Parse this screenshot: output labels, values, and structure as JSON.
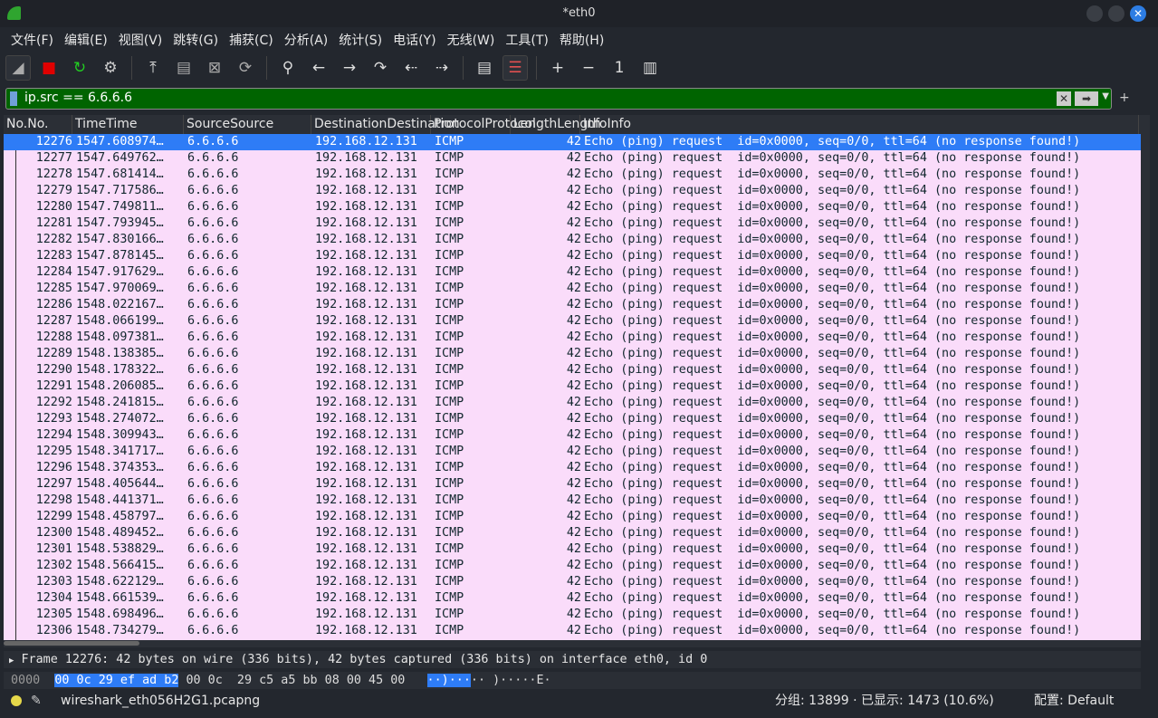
{
  "window": {
    "title": "*eth0",
    "close": "✕"
  },
  "menu": [
    "文件(F)",
    "编辑(E)",
    "视图(V)",
    "跳转(G)",
    "捕获(C)",
    "分析(A)",
    "统计(S)",
    "电话(Y)",
    "无线(W)",
    "工具(T)",
    "帮助(H)"
  ],
  "toolbar": [
    {
      "name": "start-capture-icon",
      "glyph": "◢",
      "color": "#aaaaaa"
    },
    {
      "name": "stop-capture-icon",
      "glyph": "■",
      "color": "#e00000"
    },
    {
      "name": "restart-capture-icon",
      "glyph": "↻",
      "color": "#22cc22"
    },
    {
      "name": "capture-options-icon",
      "glyph": "⚙",
      "color": "#cccccc"
    },
    {
      "name": "open-file-icon",
      "glyph": "⤒",
      "color": "#dddddd"
    },
    {
      "name": "save-file-icon",
      "glyph": "▤",
      "color": "#aaaaaa"
    },
    {
      "name": "close-file-icon",
      "glyph": "⊠",
      "color": "#aaaaaa"
    },
    {
      "name": "reload-file-icon",
      "glyph": "⟳",
      "color": "#aaaaaa"
    },
    {
      "name": "find-packet-icon",
      "glyph": "⚲",
      "color": "#dddddd"
    },
    {
      "name": "go-back-icon",
      "glyph": "←",
      "color": "#dddddd"
    },
    {
      "name": "go-forward-icon",
      "glyph": "→",
      "color": "#dddddd"
    },
    {
      "name": "go-to-packet-icon",
      "glyph": "↷",
      "color": "#dddddd"
    },
    {
      "name": "first-packet-icon",
      "glyph": "⇠",
      "color": "#dddddd"
    },
    {
      "name": "last-packet-icon",
      "glyph": "⇢",
      "color": "#dddddd"
    },
    {
      "name": "autoscroll-icon",
      "glyph": "▤",
      "color": "#dddddd"
    },
    {
      "name": "colorize-icon",
      "glyph": "☰",
      "color": "#e05050"
    },
    {
      "name": "zoom-in-icon",
      "glyph": "+",
      "color": "#dddddd"
    },
    {
      "name": "zoom-out-icon",
      "glyph": "−",
      "color": "#dddddd"
    },
    {
      "name": "normal-size-icon",
      "glyph": "1",
      "color": "#dddddd"
    },
    {
      "name": "resize-columns-icon",
      "glyph": "▥",
      "color": "#dddddd"
    }
  ],
  "filter": {
    "value": "ip.src == 6.6.6.6",
    "bg": "#006400"
  },
  "columns": [
    "No.",
    "Time",
    "Source",
    "Destination",
    "Protocol",
    "Length",
    "Info"
  ],
  "rows": [
    [
      "12276",
      "1547.608974…"
    ],
    [
      "12277",
      "1547.649762…"
    ],
    [
      "12278",
      "1547.681414…"
    ],
    [
      "12279",
      "1547.717586…"
    ],
    [
      "12280",
      "1547.749811…"
    ],
    [
      "12281",
      "1547.793945…"
    ],
    [
      "12282",
      "1547.830166…"
    ],
    [
      "12283",
      "1547.878145…"
    ],
    [
      "12284",
      "1547.917629…"
    ],
    [
      "12285",
      "1547.970069…"
    ],
    [
      "12286",
      "1548.022167…"
    ],
    [
      "12287",
      "1548.066199…"
    ],
    [
      "12288",
      "1548.097381…"
    ],
    [
      "12289",
      "1548.138385…"
    ],
    [
      "12290",
      "1548.178322…"
    ],
    [
      "12291",
      "1548.206085…"
    ],
    [
      "12292",
      "1548.241815…"
    ],
    [
      "12293",
      "1548.274072…"
    ],
    [
      "12294",
      "1548.309943…"
    ],
    [
      "12295",
      "1548.341717…"
    ],
    [
      "12296",
      "1548.374353…"
    ],
    [
      "12297",
      "1548.405644…"
    ],
    [
      "12298",
      "1548.441371…"
    ],
    [
      "12299",
      "1548.458797…"
    ],
    [
      "12300",
      "1548.489452…"
    ],
    [
      "12301",
      "1548.538829…"
    ],
    [
      "12302",
      "1548.566415…"
    ],
    [
      "12303",
      "1548.622129…"
    ],
    [
      "12304",
      "1548.661539…"
    ],
    [
      "12305",
      "1548.698496…"
    ],
    [
      "12306",
      "1548.734279…"
    ]
  ],
  "row_common": {
    "source": "6.6.6.6",
    "destination": "192.168.12.131",
    "protocol": "ICMP",
    "length": "42",
    "info": "Echo (ping) request  id=0x0000, seq=0/0, ttl=64 (no response found!)"
  },
  "selected_row": "12276",
  "colors": {
    "row_bg": "#fadcfa",
    "selected": "#2e7cf6"
  },
  "detail": "Frame 12276: 42 bytes on wire (336 bits), 42 bytes captured (336 bits) on interface eth0, id 0",
  "bytes": {
    "offset": "0000",
    "hex_sel": "00 0c 29 ef ad b2",
    "hex_rest": " 00 0c  29 c5 a5 bb 08 00 45 00",
    "ascii_sel": "··)···",
    "ascii_rest": "·· )·····E·"
  },
  "status": {
    "file": "wireshark_eth056H2G1.pcapng",
    "counts": "分组: 13899 · 已显示: 1473 (10.6%)",
    "profile": "配置: Default"
  }
}
